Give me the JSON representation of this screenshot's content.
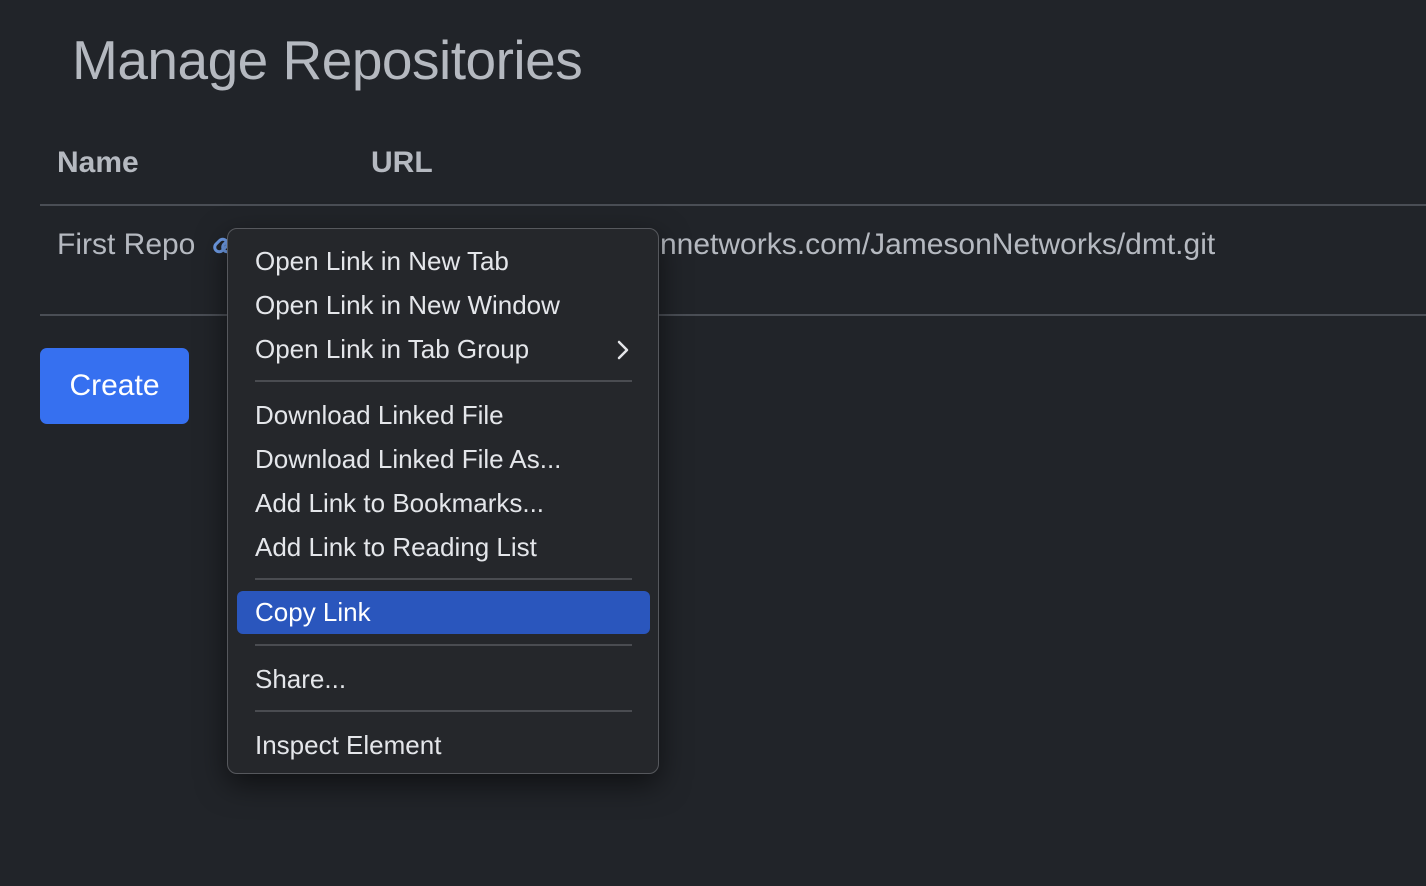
{
  "page": {
    "title": "Manage Repositories"
  },
  "table": {
    "columns": [
      "Name",
      "URL"
    ],
    "rows": [
      {
        "name": "First Repo",
        "url_visible": "nnetworks.com/JamesonNetworks/dmt.git"
      }
    ]
  },
  "buttons": {
    "create_label": "Create"
  },
  "context_menu": {
    "groups": [
      [
        {
          "label": "Open Link in New Tab"
        },
        {
          "label": "Open Link in New Window"
        },
        {
          "label": "Open Link in Tab Group",
          "has_submenu": true
        }
      ],
      [
        {
          "label": "Download Linked File"
        },
        {
          "label": "Download Linked File As..."
        },
        {
          "label": "Add Link to Bookmarks..."
        },
        {
          "label": "Add Link to Reading List"
        }
      ],
      [
        {
          "label": "Copy Link",
          "highlighted": true
        }
      ],
      [
        {
          "label": "Share..."
        }
      ],
      [
        {
          "label": "Inspect Element"
        }
      ]
    ]
  },
  "colors": {
    "background": "#212429",
    "text": "#b5b9c0",
    "accent": "#3670f0",
    "menu_highlight": "#2a56bd",
    "link_icon": "#6f9de8"
  }
}
